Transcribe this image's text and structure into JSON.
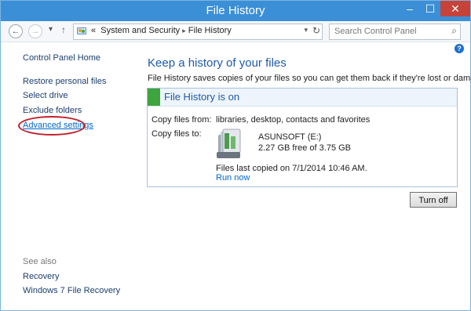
{
  "window": {
    "title": "File History",
    "min": "–",
    "max": "☐",
    "close": "✕"
  },
  "nav": {
    "back": "←",
    "forward": "→",
    "recent": "▾",
    "up": "↑",
    "breadcrumb_prefix": "«",
    "crumb1": "System and Security",
    "crumb_sep": "▸",
    "crumb2": "File History",
    "dropdown": "▾",
    "refresh": "↻",
    "search_placeholder": "Search Control Panel",
    "search_icon": "⌕"
  },
  "help": "?",
  "sidebar": {
    "home": "Control Panel Home",
    "items": [
      "Restore personal files",
      "Select drive",
      "Exclude folders",
      "Advanced settings"
    ],
    "see_also": "See also",
    "see_also_items": [
      "Recovery",
      "Windows 7 File Recovery"
    ]
  },
  "main": {
    "title": "Keep a history of your files",
    "description": "File History saves copies of your files so you can get them back if they're lost or damaged.",
    "status": "File History is on",
    "copy_from_label": "Copy files from:",
    "copy_from_value": "libraries, desktop, contacts and favorites",
    "copy_to_label": "Copy files to:",
    "drive_name": "ASUNSOFT (E:)",
    "drive_free": "2.27 GB free of 3.75 GB",
    "last_copied": "Files last copied on 7/1/2014 10:46 AM.",
    "run_now": "Run now",
    "turn_off": "Turn off"
  },
  "colors": {
    "titlebar": "#3b8fd6",
    "status_green": "#3ea53e",
    "link": "#0066cc",
    "highlight_circle": "#c0202a"
  },
  "icons": [
    "back-arrow-icon",
    "forward-arrow-icon",
    "up-arrow-icon",
    "control-panel-icon",
    "refresh-icon",
    "search-icon",
    "help-icon",
    "drive-icon"
  ]
}
